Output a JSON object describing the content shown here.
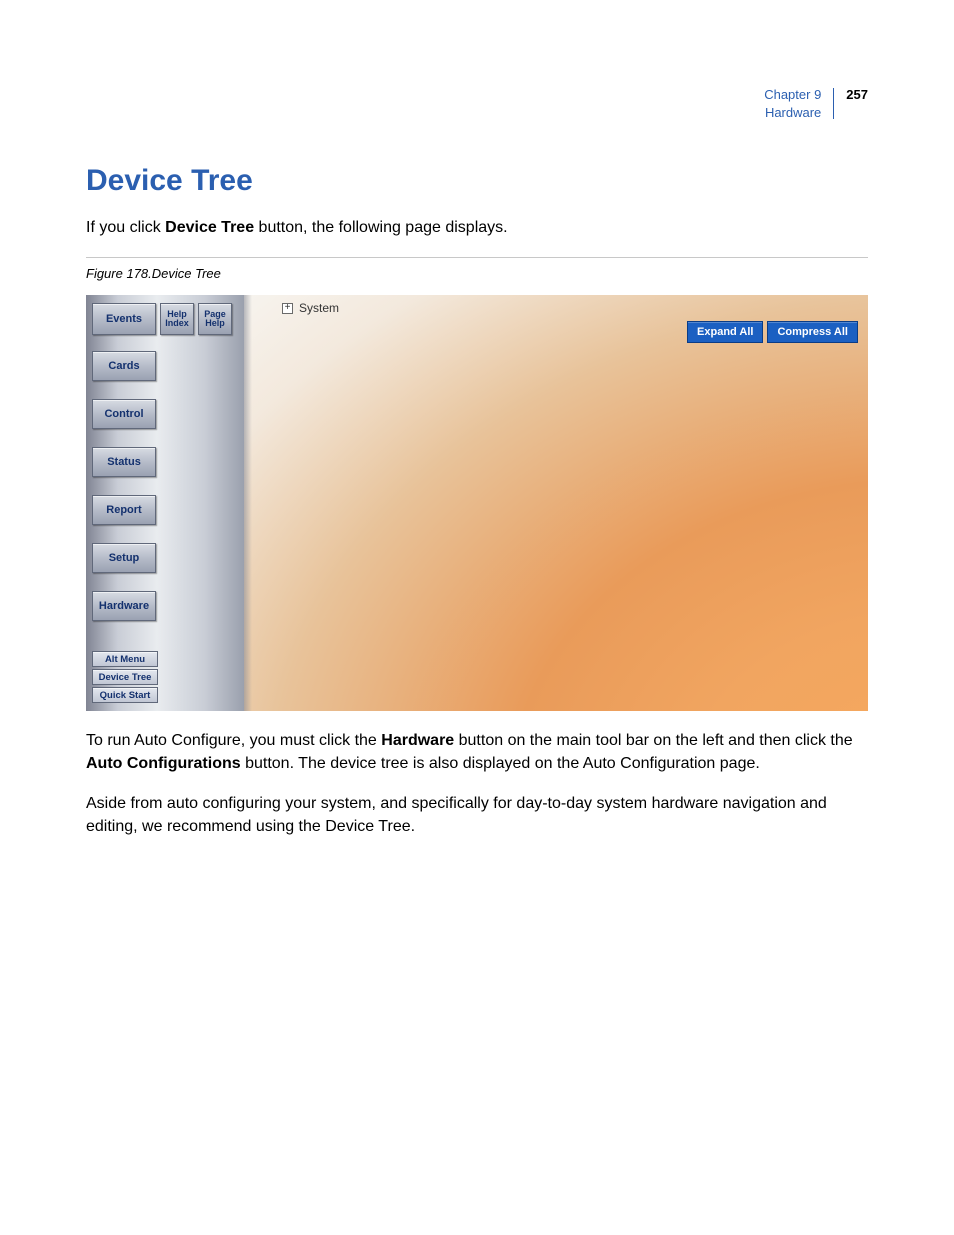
{
  "header": {
    "chapter": "Chapter 9",
    "section": "Hardware",
    "page_number": "257"
  },
  "title": "Device Tree",
  "paragraphs": {
    "intro_1": "If you click ",
    "intro_bold": "Device Tree",
    "intro_2": " button, the following page displays.",
    "p2_1": "To run Auto Configure, you must click the ",
    "p2_b1": "Hardware",
    "p2_2": " button on the main tool bar on the left and then click the ",
    "p2_b2": "Auto Configurations",
    "p2_3": " button. The device tree is also displayed on the Auto Configuration page.",
    "p3": "Aside from auto configuring your system, and specifically for day-to-day system hardware navigation and editing, we recommend using the Device Tree."
  },
  "figure": {
    "caption": "Figure 178.Device Tree",
    "sidebar": {
      "help_index": "Help Index",
      "page_help": "Page Help",
      "buttons": {
        "events": "Events",
        "cards": "Cards",
        "control": "Control",
        "status": "Status",
        "report": "Report",
        "setup": "Setup",
        "hardware": "Hardware"
      },
      "sub_buttons": {
        "alt_menu": "Alt Menu",
        "device_tree": "Device Tree",
        "quick_start": "Quick Start"
      }
    },
    "main": {
      "tree_root_label": "System",
      "expand_all": "Expand All",
      "compress_all": "Compress All"
    }
  }
}
